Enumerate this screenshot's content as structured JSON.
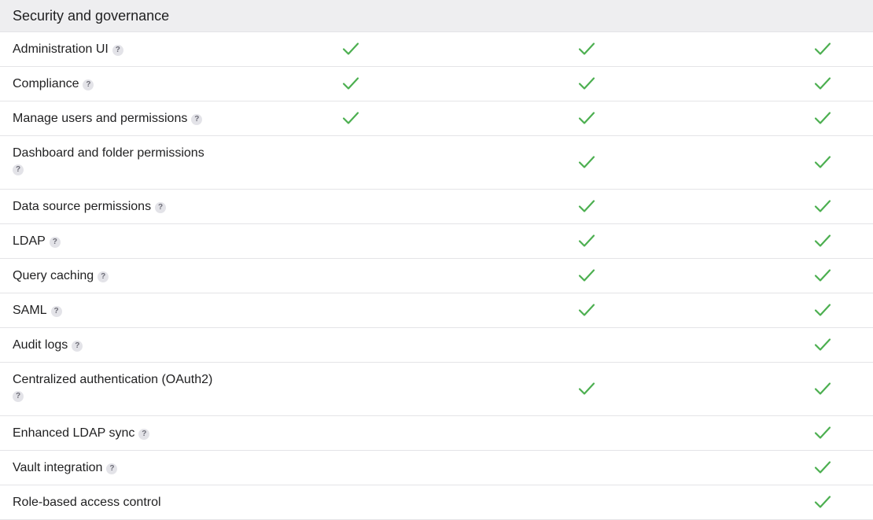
{
  "section": {
    "title": "Security and governance"
  },
  "colors": {
    "check": "#4caf50",
    "header_bg": "#eeeef0",
    "divider": "#e4e4e7"
  },
  "help_icon_glyph": "?",
  "rows": [
    {
      "label": "Administration UI",
      "help": true,
      "checks": [
        true,
        true,
        true
      ]
    },
    {
      "label": "Compliance",
      "help": true,
      "checks": [
        true,
        true,
        true
      ]
    },
    {
      "label": "Manage users and permissions",
      "help": true,
      "checks": [
        true,
        true,
        true
      ]
    },
    {
      "label": "Dashboard and folder permissions",
      "help": true,
      "checks": [
        false,
        true,
        true
      ]
    },
    {
      "label": "Data source permissions",
      "help": true,
      "checks": [
        false,
        true,
        true
      ]
    },
    {
      "label": "LDAP",
      "help": true,
      "checks": [
        false,
        true,
        true
      ]
    },
    {
      "label": "Query caching",
      "help": true,
      "checks": [
        false,
        true,
        true
      ]
    },
    {
      "label": "SAML",
      "help": true,
      "checks": [
        false,
        true,
        true
      ]
    },
    {
      "label": "Audit logs",
      "help": true,
      "checks": [
        false,
        false,
        true
      ]
    },
    {
      "label": "Centralized authentication (OAuth2)",
      "help": true,
      "checks": [
        false,
        true,
        true
      ]
    },
    {
      "label": "Enhanced LDAP sync",
      "help": true,
      "checks": [
        false,
        false,
        true
      ]
    },
    {
      "label": "Vault integration",
      "help": true,
      "checks": [
        false,
        false,
        true
      ]
    },
    {
      "label": "Role-based access control",
      "help": false,
      "checks": [
        false,
        false,
        true
      ]
    }
  ]
}
